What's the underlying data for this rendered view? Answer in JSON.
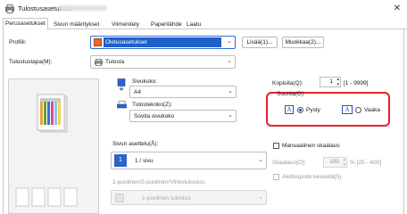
{
  "window": {
    "title": "Tulostusasetukset:",
    "close_icon": "close-icon"
  },
  "tabs": [
    {
      "label": "Perusasetukset",
      "active": true
    },
    {
      "label": "Sivun määritykset",
      "active": false
    },
    {
      "label": "Viimeistely",
      "active": false
    },
    {
      "label": "Paperilähde",
      "active": false
    },
    {
      "label": "Laatu",
      "active": false
    }
  ],
  "profile": {
    "label": "Profiili:",
    "value": "Oletusasetukset",
    "add_button": "Lisää(1)...",
    "edit_button": "Muokkaa(2)..."
  },
  "output_method": {
    "label": "Tulostustapa(M):",
    "value": "Tulosta"
  },
  "page_size": {
    "label": "Sivukoko:",
    "value": "A4"
  },
  "output_size": {
    "label": "Tulostekoko(Z):",
    "value": "Sovita sivukoko"
  },
  "copies": {
    "label": "Kopioita(Q):",
    "value": "1",
    "range": "[1 - 9999]"
  },
  "orientation": {
    "label": "Suunta(O)",
    "portrait": "Pysty",
    "landscape": "Vaaka",
    "selected": "portrait"
  },
  "page_layout": {
    "label": "Sivun asettelu(Å):",
    "value": "1 / sivu",
    "number": "1"
  },
  "manual_scaling": {
    "label": "Manuaalinen skaalaus",
    "scaling_label": "Skaalaus(O):",
    "scaling_value": "100",
    "scaling_range": "% [25 - 400]",
    "center_label": "Aloituspiste keskellä(5)"
  },
  "duplex": {
    "label": "1-puolinen/2-puolinen/Vihkotulostus:",
    "value": "1-puolinen tulostus"
  },
  "accent_color": "#e0232a"
}
